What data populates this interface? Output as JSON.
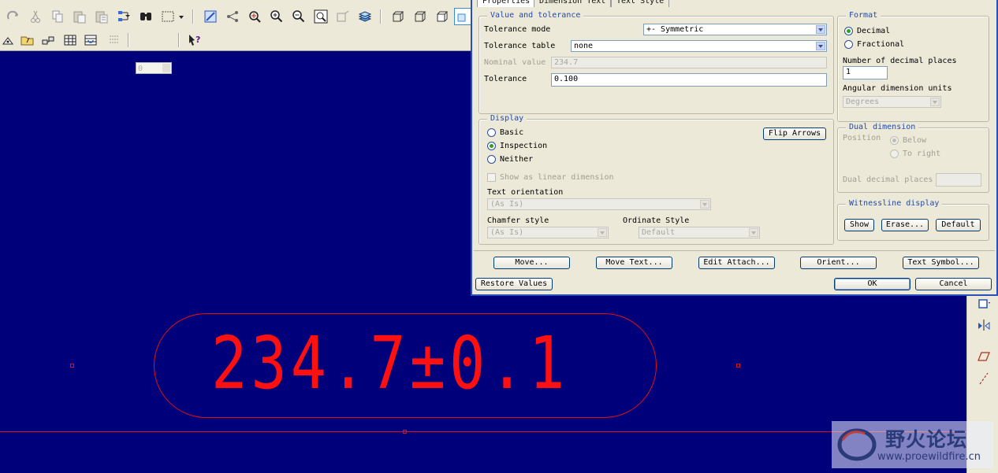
{
  "toolbar": {
    "icons_row1": [
      "redo-icon",
      "cut-icon",
      "copy-icon",
      "paste-icon",
      "paste-special-icon",
      "regenerate-icon",
      "find-icon",
      "select-box-icon",
      "repaint-icon",
      "datum-display-icon",
      "spin-center-icon",
      "zoom-in-icon",
      "zoom-out-icon",
      "refit-icon",
      "orient-icon",
      "layers-icon",
      "view-iso-icon",
      "view-hidden-icon",
      "view-no-hidden-icon"
    ],
    "icons_row2": [
      "triangle-icon",
      "open-folder-icon",
      "hierarchy-icon",
      "table-icon",
      "repeat-region-icon",
      "tolerance-icon"
    ],
    "layer_value": "0",
    "help_icon": "whats-this-help-icon"
  },
  "dialog": {
    "tabs": [
      "Properties",
      "Dimension Text",
      "Text Style"
    ],
    "value_tolerance": {
      "legend": "Value and tolerance",
      "tolerance_mode_label": "Tolerance mode",
      "tolerance_mode_value": "+- Symmetric",
      "tolerance_table_label": "Tolerance table",
      "tolerance_table_value": "none",
      "nominal_label": "Nominal value",
      "nominal_value": "234.7",
      "tolerance_label": "Tolerance",
      "tolerance_value": "0.100"
    },
    "format": {
      "legend": "Format",
      "decimal": "Decimal",
      "fractional": "Fractional",
      "decimal_places_label": "Number of decimal places",
      "decimal_places_value": "1",
      "angular_label": "Angular dimension units",
      "angular_value": "Degrees"
    },
    "display": {
      "legend": "Display",
      "basic": "Basic",
      "inspection": "Inspection",
      "neither": "Neither",
      "flip_arrows": "Flip Arrows",
      "show_linear": "Show as linear dimension",
      "text_orientation_label": "Text orientation",
      "text_orientation_value": "(As Is)",
      "chamfer_label": "Chamfer style",
      "chamfer_value": "(As Is)",
      "ordinate_label": "Ordinate Style",
      "ordinate_value": "Default"
    },
    "dual": {
      "legend": "Dual dimension",
      "position_label": "Position",
      "below": "Below",
      "to_right": "To right",
      "dual_places_label": "Dual decimal places"
    },
    "witness": {
      "legend": "Witnessline display",
      "show": "Show",
      "erase": "Erase...",
      "default": "Default"
    },
    "actions": {
      "move": "Move...",
      "move_text": "Move Text...",
      "edit_attach": "Edit Attach...",
      "orient": "Orient...",
      "text_symbol": "Text Symbol...",
      "restore": "Restore Values",
      "ok": "OK",
      "cancel": "Cancel"
    }
  },
  "canvas": {
    "dimension_text": "234.7±0.1",
    "colors": {
      "background": "#00007a",
      "dimension": "#ff1010"
    }
  },
  "side_strip_icons": [
    "new-view-icon",
    "mirror-icon",
    "plane-icon",
    "axis-line-icon"
  ],
  "watermark": {
    "text_cn": "野火论坛",
    "url": "www.proewildfire.cn"
  }
}
